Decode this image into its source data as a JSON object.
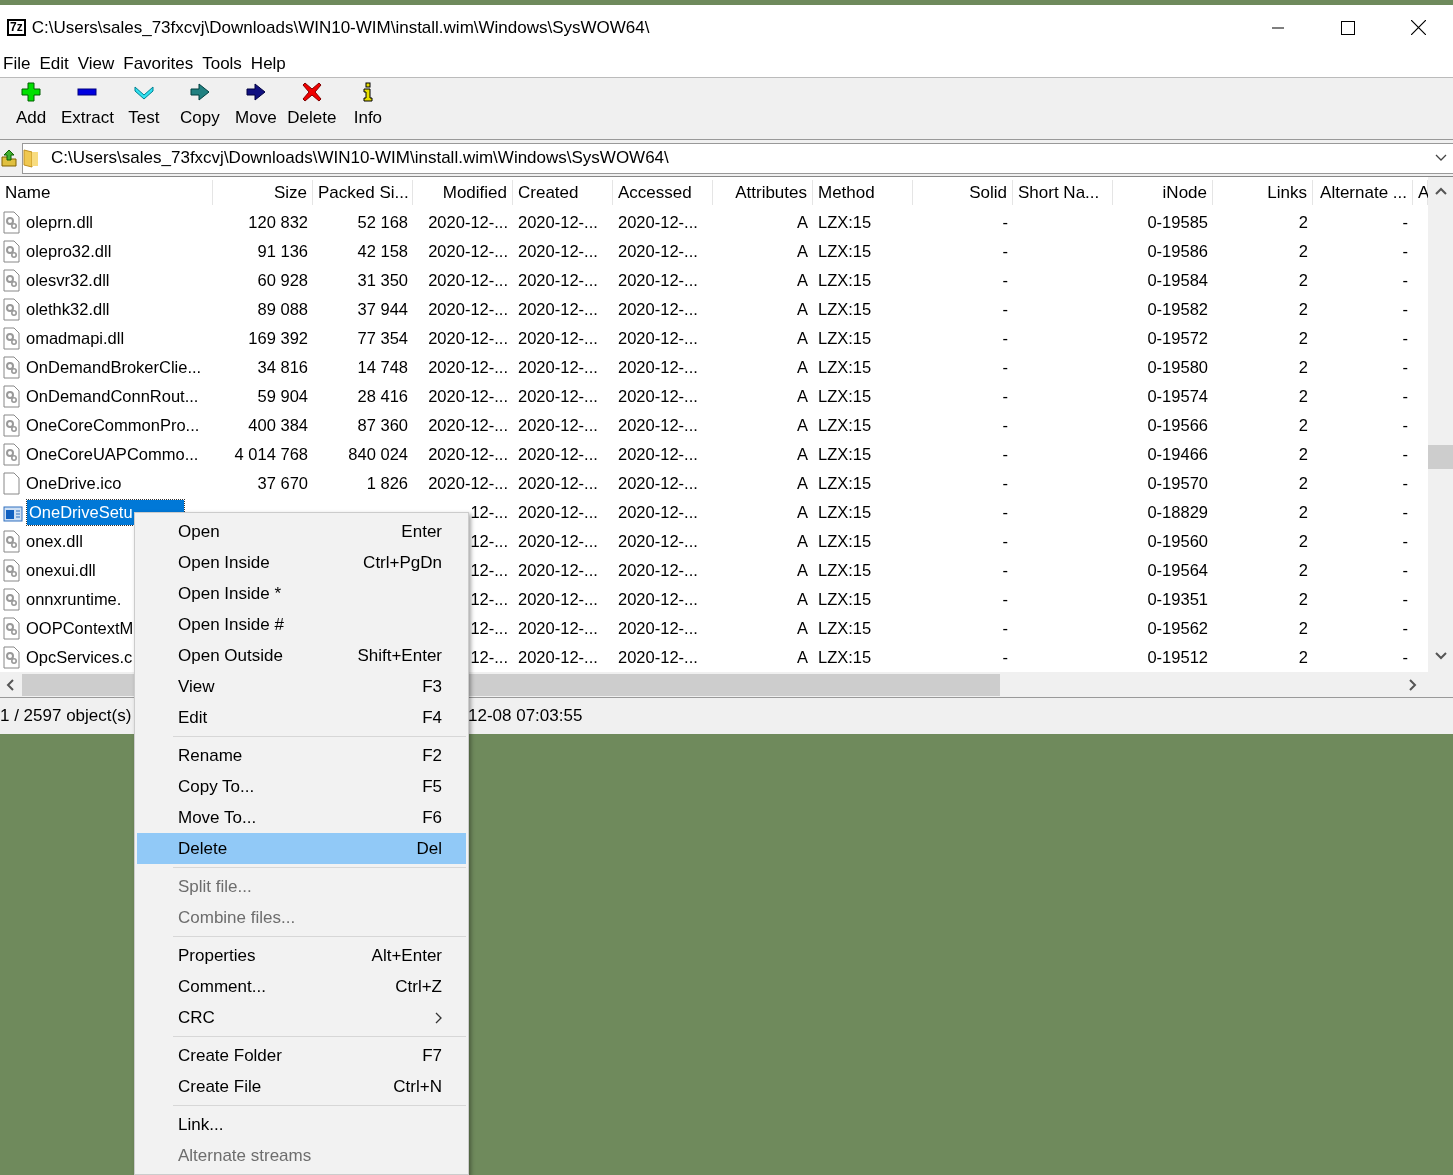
{
  "window": {
    "logo": "7z",
    "title": "C:\\Users\\sales_73fxcvj\\Downloads\\WIN10-WIM\\install.wim\\Windows\\SysWOW64\\"
  },
  "menu_bar": [
    "File",
    "Edit",
    "View",
    "Favorites",
    "Tools",
    "Help"
  ],
  "toolbar": [
    "Add",
    "Extract",
    "Test",
    "Copy",
    "Move",
    "Delete",
    "Info"
  ],
  "address": {
    "value": "C:\\Users\\sales_73fxcvj\\Downloads\\WIN10-WIM\\install.wim\\Windows\\SysWOW64\\"
  },
  "table": {
    "columns": [
      "Name",
      "Size",
      "Packed Si...",
      "Modified",
      "Created",
      "Accessed",
      "Attributes",
      "Method",
      "Solid",
      "Short Na...",
      "iNode",
      "Links",
      "Alternate ...",
      "A"
    ],
    "rows": [
      {
        "kind": "dll",
        "selected": false,
        "name": "oleprn.dll",
        "size": "120 832",
        "packed": "52 168",
        "modified": "2020-12-...",
        "created": "2020-12-...",
        "accessed": "2020-12-...",
        "attributes": "A",
        "method": "LZX:15",
        "solid": "-",
        "inode": "0-19585",
        "links": "2",
        "alternate": "-"
      },
      {
        "kind": "dll",
        "selected": false,
        "name": "olepro32.dll",
        "size": "91 136",
        "packed": "42 158",
        "modified": "2020-12-...",
        "created": "2020-12-...",
        "accessed": "2020-12-...",
        "attributes": "A",
        "method": "LZX:15",
        "solid": "-",
        "inode": "0-19586",
        "links": "2",
        "alternate": "-"
      },
      {
        "kind": "dll",
        "selected": false,
        "name": "olesvr32.dll",
        "size": "60 928",
        "packed": "31 350",
        "modified": "2020-12-...",
        "created": "2020-12-...",
        "accessed": "2020-12-...",
        "attributes": "A",
        "method": "LZX:15",
        "solid": "-",
        "inode": "0-19584",
        "links": "2",
        "alternate": "-"
      },
      {
        "kind": "dll",
        "selected": false,
        "name": "olethk32.dll",
        "size": "89 088",
        "packed": "37 944",
        "modified": "2020-12-...",
        "created": "2020-12-...",
        "accessed": "2020-12-...",
        "attributes": "A",
        "method": "LZX:15",
        "solid": "-",
        "inode": "0-19582",
        "links": "2",
        "alternate": "-"
      },
      {
        "kind": "dll",
        "selected": false,
        "name": "omadmapi.dll",
        "size": "169 392",
        "packed": "77 354",
        "modified": "2020-12-...",
        "created": "2020-12-...",
        "accessed": "2020-12-...",
        "attributes": "A",
        "method": "LZX:15",
        "solid": "-",
        "inode": "0-19572",
        "links": "2",
        "alternate": "-"
      },
      {
        "kind": "dll",
        "selected": false,
        "name": "OnDemandBrokerClie...",
        "size": "34 816",
        "packed": "14 748",
        "modified": "2020-12-...",
        "created": "2020-12-...",
        "accessed": "2020-12-...",
        "attributes": "A",
        "method": "LZX:15",
        "solid": "-",
        "inode": "0-19580",
        "links": "2",
        "alternate": "-"
      },
      {
        "kind": "dll",
        "selected": false,
        "name": "OnDemandConnRout...",
        "size": "59 904",
        "packed": "28 416",
        "modified": "2020-12-...",
        "created": "2020-12-...",
        "accessed": "2020-12-...",
        "attributes": "A",
        "method": "LZX:15",
        "solid": "-",
        "inode": "0-19574",
        "links": "2",
        "alternate": "-"
      },
      {
        "kind": "dll",
        "selected": false,
        "name": "OneCoreCommonPro...",
        "size": "400 384",
        "packed": "87 360",
        "modified": "2020-12-...",
        "created": "2020-12-...",
        "accessed": "2020-12-...",
        "attributes": "A",
        "method": "LZX:15",
        "solid": "-",
        "inode": "0-19566",
        "links": "2",
        "alternate": "-"
      },
      {
        "kind": "dll",
        "selected": false,
        "name": "OneCoreUAPCommo...",
        "size": "4 014 768",
        "packed": "840 024",
        "modified": "2020-12-...",
        "created": "2020-12-...",
        "accessed": "2020-12-...",
        "attributes": "A",
        "method": "LZX:15",
        "solid": "-",
        "inode": "0-19466",
        "links": "2",
        "alternate": "-"
      },
      {
        "kind": "file",
        "selected": false,
        "name": "OneDrive.ico",
        "size": "37 670",
        "packed": "1 826",
        "modified": "2020-12-...",
        "created": "2020-12-...",
        "accessed": "2020-12-...",
        "attributes": "A",
        "method": "LZX:15",
        "solid": "-",
        "inode": "0-19570",
        "links": "2",
        "alternate": "-"
      },
      {
        "kind": "exe",
        "selected": true,
        "name": "OneDriveSetu",
        "modified": "12-...",
        "created": "2020-12-...",
        "accessed": "2020-12-...",
        "attributes": "A",
        "method": "LZX:15",
        "solid": "-",
        "inode": "0-18829",
        "links": "2",
        "alternate": "-"
      },
      {
        "kind": "dll",
        "selected": false,
        "name": "onex.dll",
        "modified": "12-...",
        "created": "2020-12-...",
        "accessed": "2020-12-...",
        "attributes": "A",
        "method": "LZX:15",
        "solid": "-",
        "inode": "0-19560",
        "links": "2",
        "alternate": "-"
      },
      {
        "kind": "dll",
        "selected": false,
        "name": "onexui.dll",
        "modified": "12-...",
        "created": "2020-12-...",
        "accessed": "2020-12-...",
        "attributes": "A",
        "method": "LZX:15",
        "solid": "-",
        "inode": "0-19564",
        "links": "2",
        "alternate": "-"
      },
      {
        "kind": "dll",
        "selected": false,
        "name": "onnxruntime.",
        "modified": "12-...",
        "created": "2020-12-...",
        "accessed": "2020-12-...",
        "attributes": "A",
        "method": "LZX:15",
        "solid": "-",
        "inode": "0-19351",
        "links": "2",
        "alternate": "-"
      },
      {
        "kind": "dll",
        "selected": false,
        "name": "OOPContextM",
        "modified": "12-...",
        "created": "2020-12-...",
        "accessed": "2020-12-...",
        "attributes": "A",
        "method": "LZX:15",
        "solid": "-",
        "inode": "0-19562",
        "links": "2",
        "alternate": "-"
      },
      {
        "kind": "dll",
        "selected": false,
        "name": "OpcServices.c",
        "modified": "12-...",
        "created": "2020-12-...",
        "accessed": "2020-12-...",
        "attributes": "A",
        "method": "LZX:15",
        "solid": "-",
        "inode": "0-19512",
        "links": "2",
        "alternate": "-"
      }
    ]
  },
  "status_bar": [
    "1 / 2597 object(s)",
    "12-08 07:03:55"
  ],
  "context_menu": {
    "groups": [
      [
        {
          "kind": "command",
          "label": "Open",
          "shortcut": "Enter",
          "selected": false,
          "disabled": false
        },
        {
          "kind": "command",
          "label": "Open Inside",
          "shortcut": "Ctrl+PgDn",
          "selected": false,
          "disabled": false
        },
        {
          "kind": "command",
          "label": "Open Inside *",
          "selected": false,
          "disabled": false
        },
        {
          "kind": "command",
          "label": "Open Inside #",
          "selected": false,
          "disabled": false
        },
        {
          "kind": "command",
          "label": "Open Outside",
          "shortcut": "Shift+Enter",
          "selected": false,
          "disabled": false
        },
        {
          "kind": "command",
          "label": "View",
          "shortcut": "F3",
          "selected": false,
          "disabled": false
        },
        {
          "kind": "command",
          "label": "Edit",
          "shortcut": "F4",
          "selected": false,
          "disabled": false
        }
      ],
      [
        {
          "kind": "command",
          "label": "Rename",
          "shortcut": "F2",
          "selected": false,
          "disabled": false
        },
        {
          "kind": "command",
          "label": "Copy To...",
          "shortcut": "F5",
          "selected": false,
          "disabled": false
        },
        {
          "kind": "command",
          "label": "Move To...",
          "shortcut": "F6",
          "selected": false,
          "disabled": false
        },
        {
          "kind": "command",
          "label": "Delete",
          "shortcut": "Del",
          "selected": true,
          "disabled": false
        }
      ],
      [
        {
          "kind": "command",
          "label": "Split file...",
          "selected": false,
          "disabled": true
        },
        {
          "kind": "command",
          "label": "Combine files...",
          "selected": false,
          "disabled": true
        }
      ],
      [
        {
          "kind": "command",
          "label": "Properties",
          "shortcut": "Alt+Enter",
          "selected": false,
          "disabled": false
        },
        {
          "kind": "command",
          "label": "Comment...",
          "shortcut": "Ctrl+Z",
          "selected": false,
          "disabled": false
        },
        {
          "kind": "submenu",
          "label": "CRC",
          "selected": false,
          "disabled": false
        }
      ],
      [
        {
          "kind": "command",
          "label": "Create Folder",
          "shortcut": "F7",
          "selected": false,
          "disabled": false
        },
        {
          "kind": "command",
          "label": "Create File",
          "shortcut": "Ctrl+N",
          "selected": false,
          "disabled": false
        }
      ],
      [
        {
          "kind": "command",
          "label": "Link...",
          "selected": false,
          "disabled": false
        },
        {
          "kind": "command",
          "label": "Alternate streams",
          "selected": false,
          "disabled": true
        }
      ]
    ]
  }
}
